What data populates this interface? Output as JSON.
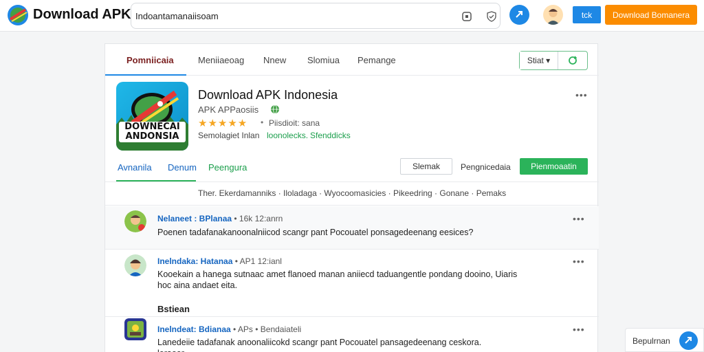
{
  "header": {
    "brand": "Download APK",
    "search_value": "Indoantamanaiisoam",
    "tick_button": "tck",
    "download_button": "Download Bomanera"
  },
  "tabs": [
    {
      "label": "Pomniicaia",
      "active": true
    },
    {
      "label": "Meniiaeoag",
      "active": false
    },
    {
      "label": "Nnew",
      "active": false
    },
    {
      "label": "Slomiua",
      "active": false
    },
    {
      "label": "Pemange",
      "active": false
    }
  ],
  "tab_actions": {
    "select_label": "Stiat"
  },
  "app": {
    "icon_text_line1": "DOWNECAI",
    "icon_text_line2": "ANDONSIA",
    "title": "Download APK Indonesia",
    "subtitle": "APK APPaosiis",
    "stars": "★★★★★",
    "separator": "•",
    "rating_text": "Piisdioit: sana",
    "meta_label": "Semolagiet Inlan",
    "meta_links": [
      "loonolecks.",
      "Sfenddicks"
    ]
  },
  "subtabs": [
    {
      "label": "Avnanila"
    },
    {
      "label": "Denum"
    },
    {
      "label": "Peengura"
    }
  ],
  "actions": {
    "outline": "Slemak",
    "text": "Pengnicedaia",
    "primary": "Pienmoaatin"
  },
  "filters": "Ther. Ekerdamanniks · Iloladaga · Wyocoomasicies · Pikeedring · Gonane · Pemaks",
  "comments": [
    {
      "name": "Nelaneet : BPlanaa",
      "time": "• 16k 12:anrn",
      "text": "Poenen tadafanakanoonalniicod scangr pant Pocouatel ponsagedeenang eesices?"
    },
    {
      "name": "Inelndaka: Hatanaa",
      "time": "• AP1 12:ianl",
      "text": "Kooekain a hanega sutnaac amet flanoed manan aniiecd taduangentle pondang dooino, Uiaris hoc aina andaet eita."
    },
    {
      "name": "Inelndeat: Bdianaa",
      "time": "• APs • Bendaiateli",
      "text": "Lanedeiie tadafanak anoonaliicokd scangr pant Pocouatel pansagedeenang ceskora. leraoer"
    }
  ],
  "section_title": "Bstiean",
  "help": {
    "label": "Bepulrnan"
  },
  "colors": {
    "accent_blue": "#1e88e5",
    "accent_green": "#2bb35a",
    "orange": "#fb8c00",
    "star": "#f5a623"
  }
}
